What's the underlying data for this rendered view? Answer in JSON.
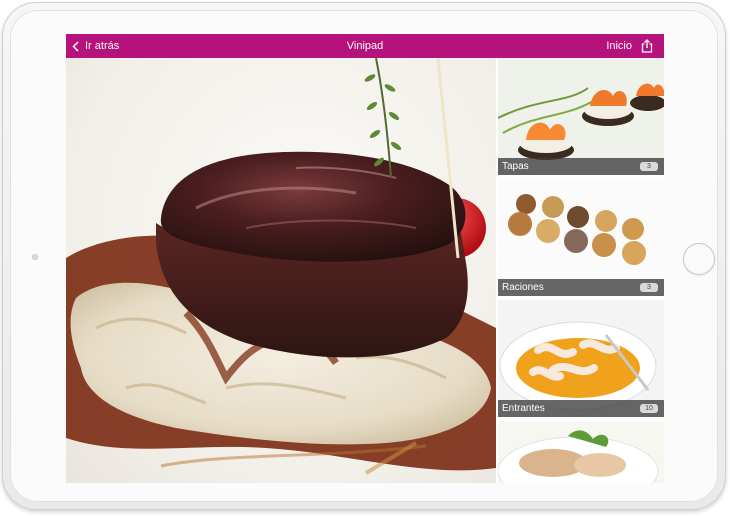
{
  "navbar": {
    "back_label": "Ir atrás",
    "title": "Vinipad",
    "home_label": "Inicio",
    "share_icon": "share-icon",
    "background_color": "#b5127b"
  },
  "categories": [
    {
      "label": "Tapas",
      "count": "3"
    },
    {
      "label": "Raciones",
      "count": "3"
    },
    {
      "label": "Entrantes",
      "count": "10"
    },
    {
      "label": "",
      "count": ""
    }
  ]
}
